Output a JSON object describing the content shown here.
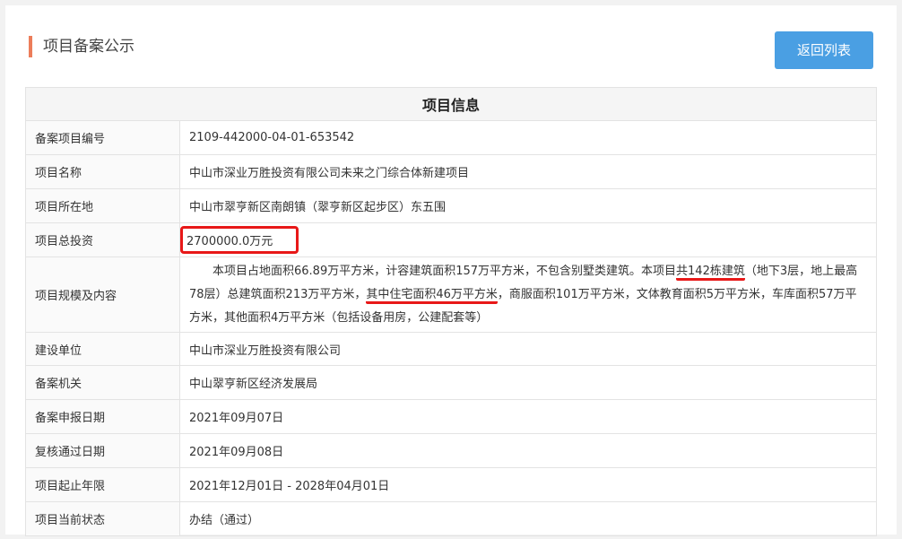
{
  "header": {
    "title": "项目备案公示",
    "back_button": "返回列表"
  },
  "table": {
    "heading": "项目信息",
    "rows": [
      {
        "label": "备案项目编号",
        "value": "2109-442000-04-01-653542"
      },
      {
        "label": "项目名称",
        "value": "中山市深业万胜投资有限公司未来之门综合体新建项目"
      },
      {
        "label": "项目所在地",
        "value": "中山市翠亨新区南朗镇（翠亨新区起步区）东五围"
      },
      {
        "label": "项目总投资",
        "value": "2700000.0万元"
      },
      {
        "label": "项目规模及内容",
        "value_parts": {
          "p1": "本项目占地面积66.89万平方米，计容建筑面积157万平方米，不包含别墅类建筑。本项目",
          "p2": "共142栋建筑",
          "p3": "（地下3层，地上最高78层）总建筑面积213万平方米，",
          "p4": "其中住宅面积46万平方米",
          "p5": "，商服面积101万平方米，文体教育面积5万平方米，车库面积57万平方米，其他面积4万平方米（包括设备用房，公建配套等）"
        }
      },
      {
        "label": "建设单位",
        "value": "中山市深业万胜投资有限公司"
      },
      {
        "label": "备案机关",
        "value": "中山翠亨新区经济发展局"
      },
      {
        "label": "备案申报日期",
        "value": "2021年09月07日"
      },
      {
        "label": "复核通过日期",
        "value": "2021年09月08日"
      },
      {
        "label": "项目起止年限",
        "value": "2021年12月01日 - 2028年04月01日"
      },
      {
        "label": "项目当前状态",
        "value": "办结（通过）"
      }
    ]
  },
  "colors": {
    "accent_bar": "#ec7d5a",
    "button": "#4a9fe3",
    "annotation": "#e81818"
  }
}
